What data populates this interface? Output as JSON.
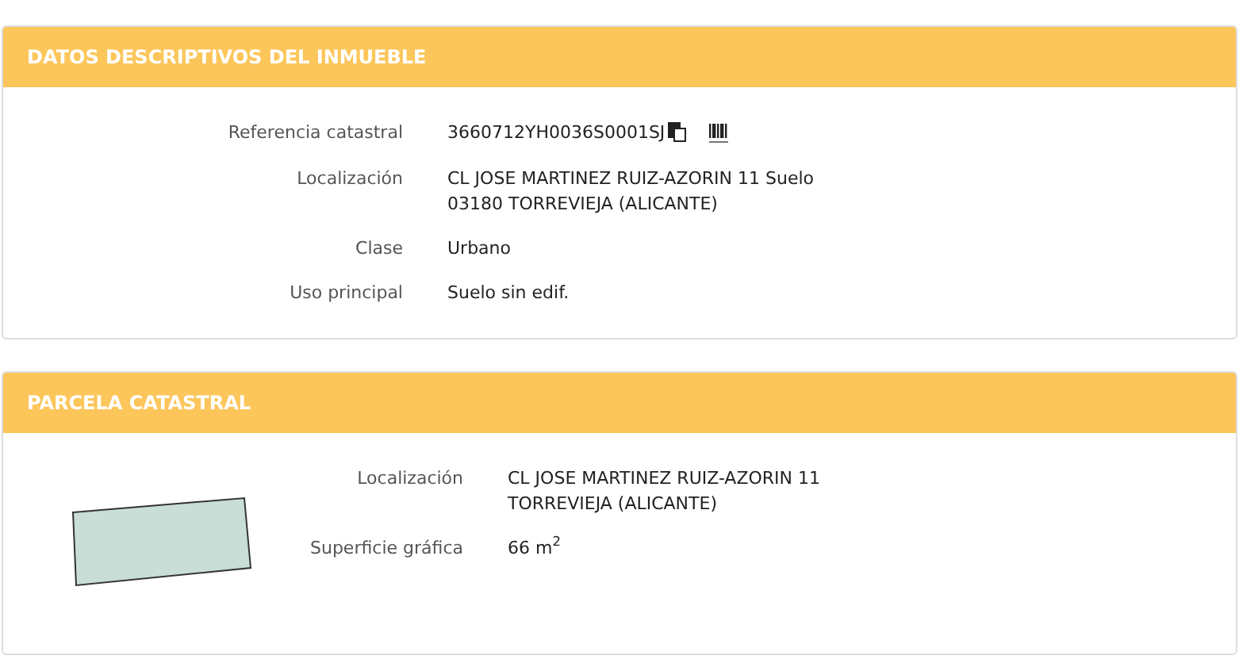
{
  "sections": [
    {
      "title": "DATOS DESCRIPTIVOS DEL INMUEBLE",
      "kind": "fields",
      "rows": [
        {
          "label": "Referencia catastral",
          "kind": "reference",
          "lines": [
            "3660712YH0036S0001SJ"
          ]
        },
        {
          "label": "Localización",
          "kind": "text",
          "lines": [
            "CL JOSE MARTINEZ RUIZ-AZORIN 11 Suelo",
            "03180 TORREVIEJA (ALICANTE)"
          ]
        },
        {
          "label": "Clase",
          "kind": "text",
          "lines": [
            "Urbano"
          ]
        },
        {
          "label": "Uso principal",
          "kind": "text",
          "lines": [
            "Suelo sin edif."
          ]
        }
      ]
    },
    {
      "title": "PARCELA CATASTRAL",
      "kind": "parcel",
      "rows": [
        {
          "label": "Localización",
          "kind": "text",
          "lines": [
            "CL JOSE MARTINEZ RUIZ-AZORIN 11",
            "TORREVIEJA (ALICANTE)"
          ]
        },
        {
          "label": "Superficie gráfica",
          "kind": "text",
          "lines": [
            "66 m$^{2}$"
          ]
        }
      ]
    }
  ]
}
